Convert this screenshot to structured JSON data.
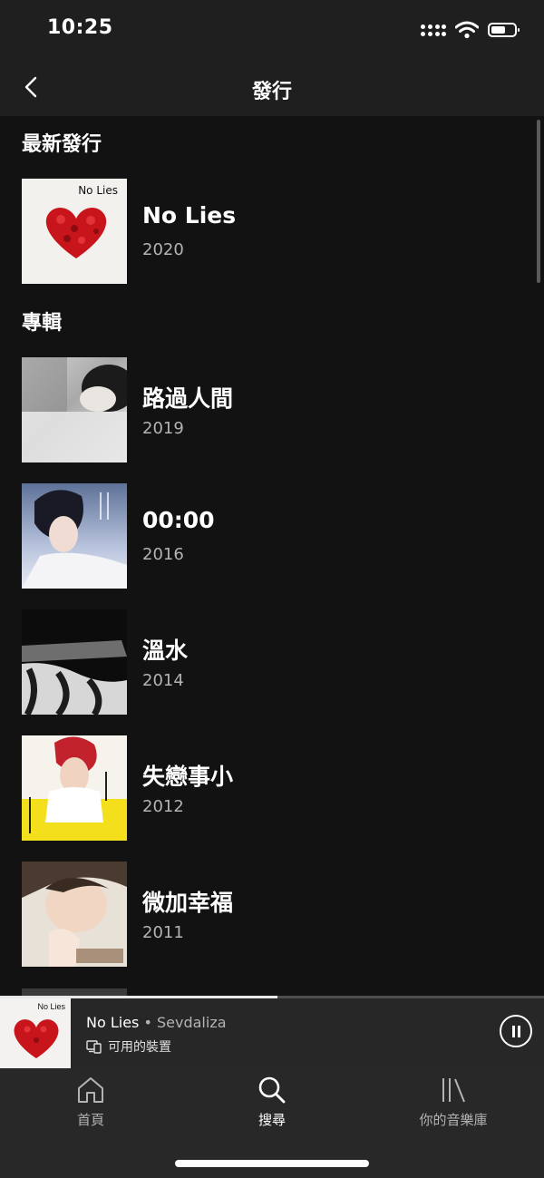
{
  "status": {
    "time": "10:25",
    "icons": [
      "signal-icon",
      "wifi-icon",
      "battery-icon"
    ]
  },
  "header": {
    "title": "發行",
    "back_icon": "chevron-left-icon"
  },
  "latest": {
    "section_title": "最新發行",
    "item": {
      "title": "No Lies",
      "year": "2020",
      "cover_text": "No Lies"
    }
  },
  "albums": {
    "section_title": "專輯",
    "items": [
      {
        "title": "路過人間",
        "year": "2019"
      },
      {
        "title": "00:00",
        "year": "2016"
      },
      {
        "title": "溫水",
        "year": "2014"
      },
      {
        "title": "失戀事小",
        "year": "2012"
      },
      {
        "title": "微加幸福",
        "year": "2011"
      }
    ]
  },
  "player": {
    "track": "No Lies",
    "separator": " • ",
    "artist": "Sevdaliza",
    "device_label": "可用的裝置",
    "cover_text": "No Lies",
    "progress": 0.51,
    "icons": [
      "devices-icon",
      "pause-icon"
    ]
  },
  "tabs": [
    {
      "label": "首頁",
      "icon": "home-icon",
      "active": false
    },
    {
      "label": "搜尋",
      "icon": "search-icon",
      "active": true
    },
    {
      "label": "你的音樂庫",
      "icon": "library-icon",
      "active": false
    }
  ],
  "colors": {
    "background": "#121212",
    "bar": "#1f1f1f",
    "secondary_text": "#b3b3b3"
  }
}
